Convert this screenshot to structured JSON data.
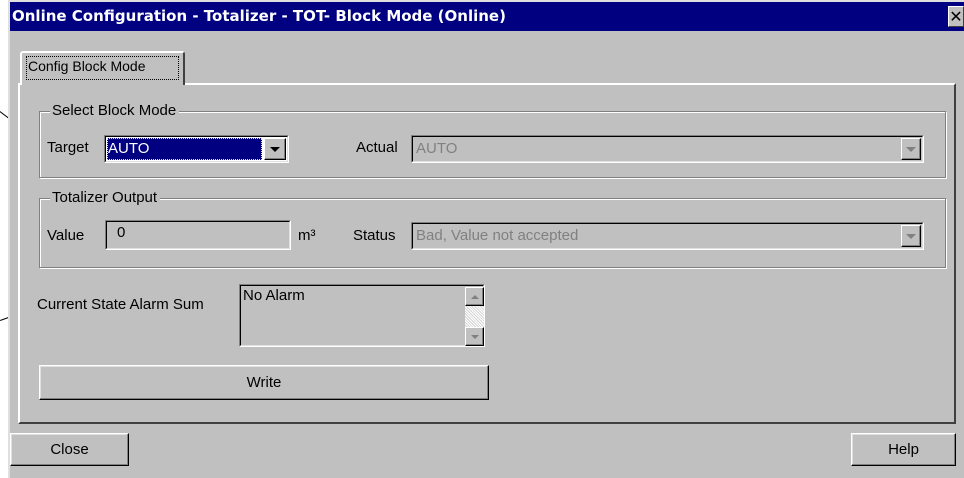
{
  "window": {
    "title": "Online Configuration - Totalizer - TOT- Block Mode  (Online)",
    "close_glyph": "✕"
  },
  "tabs": [
    {
      "label": "Config Block Mode",
      "selected": true
    }
  ],
  "block_mode": {
    "group_label": "Select Block Mode",
    "target_label": "Target",
    "target_value": "AUTO",
    "actual_label": "Actual",
    "actual_value": "AUTO"
  },
  "totalizer_output": {
    "group_label": "Totalizer Output",
    "value_label": "Value",
    "value": "0",
    "unit": "m³",
    "status_label": "Status",
    "status_value": "Bad, Value not accepted"
  },
  "alarm": {
    "label": "Current State Alarm Sum",
    "value": "No Alarm"
  },
  "buttons": {
    "write": "Write",
    "close": "Close",
    "help": "Help"
  },
  "icons": [
    "chevron-down-icon",
    "scroll-up-icon",
    "scroll-down-icon",
    "close-icon"
  ],
  "colors": {
    "titlebar": "#000080",
    "face": "#c0c0c0",
    "selection": "#000080",
    "disabled_text": "#808080"
  }
}
